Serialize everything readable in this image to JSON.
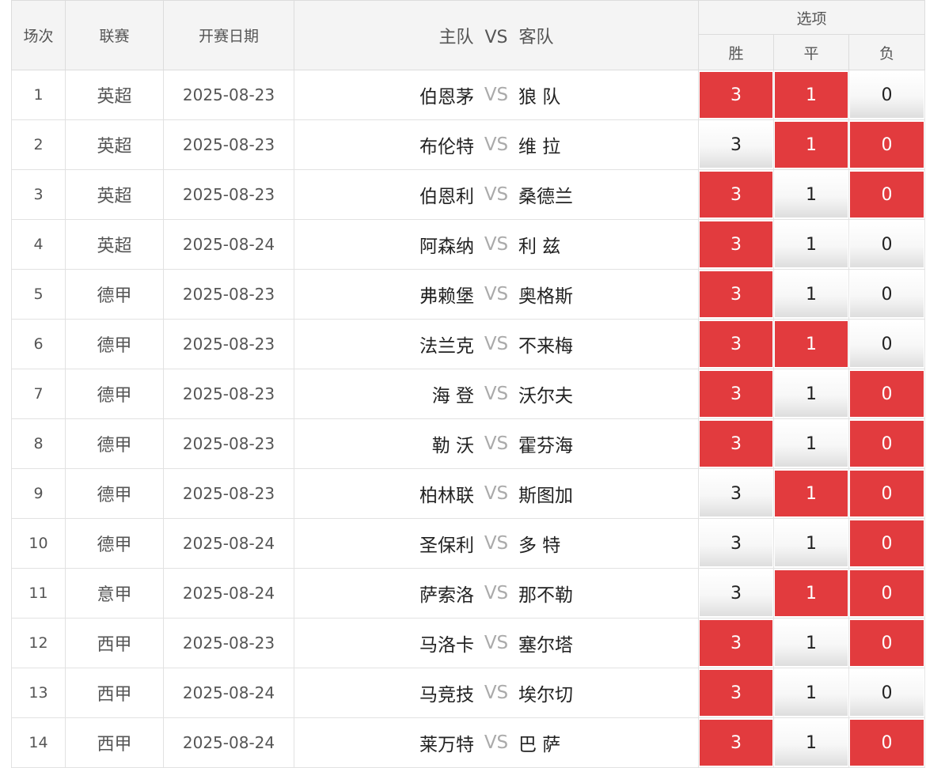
{
  "header": {
    "round": "场次",
    "league": "联赛",
    "date": "开赛日期",
    "home": "主队",
    "vs": "VS",
    "away": "客队",
    "options": "选项",
    "win": "胜",
    "draw": "平",
    "loss": "负"
  },
  "colors": {
    "selected": "#e23b3e"
  },
  "rows": [
    {
      "no": "1",
      "league": "英超",
      "date": "2025-08-23",
      "home": "伯恩茅",
      "vs": "VS",
      "away": "狼 队",
      "w": "3",
      "d": "1",
      "l": "0",
      "w_on": true,
      "d_on": true,
      "l_on": false
    },
    {
      "no": "2",
      "league": "英超",
      "date": "2025-08-23",
      "home": "布伦特",
      "vs": "VS",
      "away": "维 拉",
      "w": "3",
      "d": "1",
      "l": "0",
      "w_on": false,
      "d_on": true,
      "l_on": true
    },
    {
      "no": "3",
      "league": "英超",
      "date": "2025-08-23",
      "home": "伯恩利",
      "vs": "VS",
      "away": "桑德兰",
      "w": "3",
      "d": "1",
      "l": "0",
      "w_on": true,
      "d_on": false,
      "l_on": true
    },
    {
      "no": "4",
      "league": "英超",
      "date": "2025-08-24",
      "home": "阿森纳",
      "vs": "VS",
      "away": "利 兹",
      "w": "3",
      "d": "1",
      "l": "0",
      "w_on": true,
      "d_on": false,
      "l_on": false
    },
    {
      "no": "5",
      "league": "德甲",
      "date": "2025-08-23",
      "home": "弗赖堡",
      "vs": "VS",
      "away": "奥格斯",
      "w": "3",
      "d": "1",
      "l": "0",
      "w_on": true,
      "d_on": false,
      "l_on": false
    },
    {
      "no": "6",
      "league": "德甲",
      "date": "2025-08-23",
      "home": "法兰克",
      "vs": "VS",
      "away": "不来梅",
      "w": "3",
      "d": "1",
      "l": "0",
      "w_on": true,
      "d_on": true,
      "l_on": false
    },
    {
      "no": "7",
      "league": "德甲",
      "date": "2025-08-23",
      "home": "海 登",
      "vs": "VS",
      "away": "沃尔夫",
      "w": "3",
      "d": "1",
      "l": "0",
      "w_on": true,
      "d_on": false,
      "l_on": true
    },
    {
      "no": "8",
      "league": "德甲",
      "date": "2025-08-23",
      "home": "勒 沃",
      "vs": "VS",
      "away": "霍芬海",
      "w": "3",
      "d": "1",
      "l": "0",
      "w_on": true,
      "d_on": false,
      "l_on": true
    },
    {
      "no": "9",
      "league": "德甲",
      "date": "2025-08-23",
      "home": "柏林联",
      "vs": "VS",
      "away": "斯图加",
      "w": "3",
      "d": "1",
      "l": "0",
      "w_on": false,
      "d_on": true,
      "l_on": true
    },
    {
      "no": "10",
      "league": "德甲",
      "date": "2025-08-24",
      "home": "圣保利",
      "vs": "VS",
      "away": "多 特",
      "w": "3",
      "d": "1",
      "l": "0",
      "w_on": false,
      "d_on": false,
      "l_on": true
    },
    {
      "no": "11",
      "league": "意甲",
      "date": "2025-08-24",
      "home": "萨索洛",
      "vs": "VS",
      "away": "那不勒",
      "w": "3",
      "d": "1",
      "l": "0",
      "w_on": false,
      "d_on": true,
      "l_on": true
    },
    {
      "no": "12",
      "league": "西甲",
      "date": "2025-08-23",
      "home": "马洛卡",
      "vs": "VS",
      "away": "塞尔塔",
      "w": "3",
      "d": "1",
      "l": "0",
      "w_on": true,
      "d_on": false,
      "l_on": true
    },
    {
      "no": "13",
      "league": "西甲",
      "date": "2025-08-24",
      "home": "马竞技",
      "vs": "VS",
      "away": "埃尔切",
      "w": "3",
      "d": "1",
      "l": "0",
      "w_on": true,
      "d_on": false,
      "l_on": false
    },
    {
      "no": "14",
      "league": "西甲",
      "date": "2025-08-24",
      "home": "莱万特",
      "vs": "VS",
      "away": "巴 萨",
      "w": "3",
      "d": "1",
      "l": "0",
      "w_on": true,
      "d_on": false,
      "l_on": true
    }
  ]
}
